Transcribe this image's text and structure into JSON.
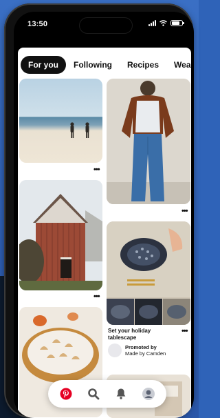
{
  "status_bar": {
    "time": "13:50"
  },
  "tabs": [
    {
      "label": "For you",
      "active": true
    },
    {
      "label": "Following",
      "active": false
    },
    {
      "label": "Recipes",
      "active": false
    },
    {
      "label": "Wear",
      "active": false
    }
  ],
  "pins": {
    "beach": {
      "subject": "people walking on beach"
    },
    "barn": {
      "subject": "red wooden barn"
    },
    "pie": {
      "subject": "meringue pie"
    },
    "jeans": {
      "subject": "woman in jeans and leather jacket"
    },
    "promoted": {
      "subject": "holiday table place setting",
      "title": "Set your holiday tablescape",
      "promoted_label": "Promoted by",
      "advertiser": "Made by Camden"
    }
  },
  "more_label": "•••",
  "bottom_nav": [
    {
      "icon": "pinterest-logo-icon",
      "label": "Home"
    },
    {
      "icon": "search-icon",
      "label": "Search"
    },
    {
      "icon": "bell-icon",
      "label": "Notifications"
    },
    {
      "icon": "profile-avatar-icon",
      "label": "Profile"
    }
  ],
  "colors": {
    "brand": "#E60023",
    "active_tab": "#111111",
    "background": "#2f63b8"
  }
}
